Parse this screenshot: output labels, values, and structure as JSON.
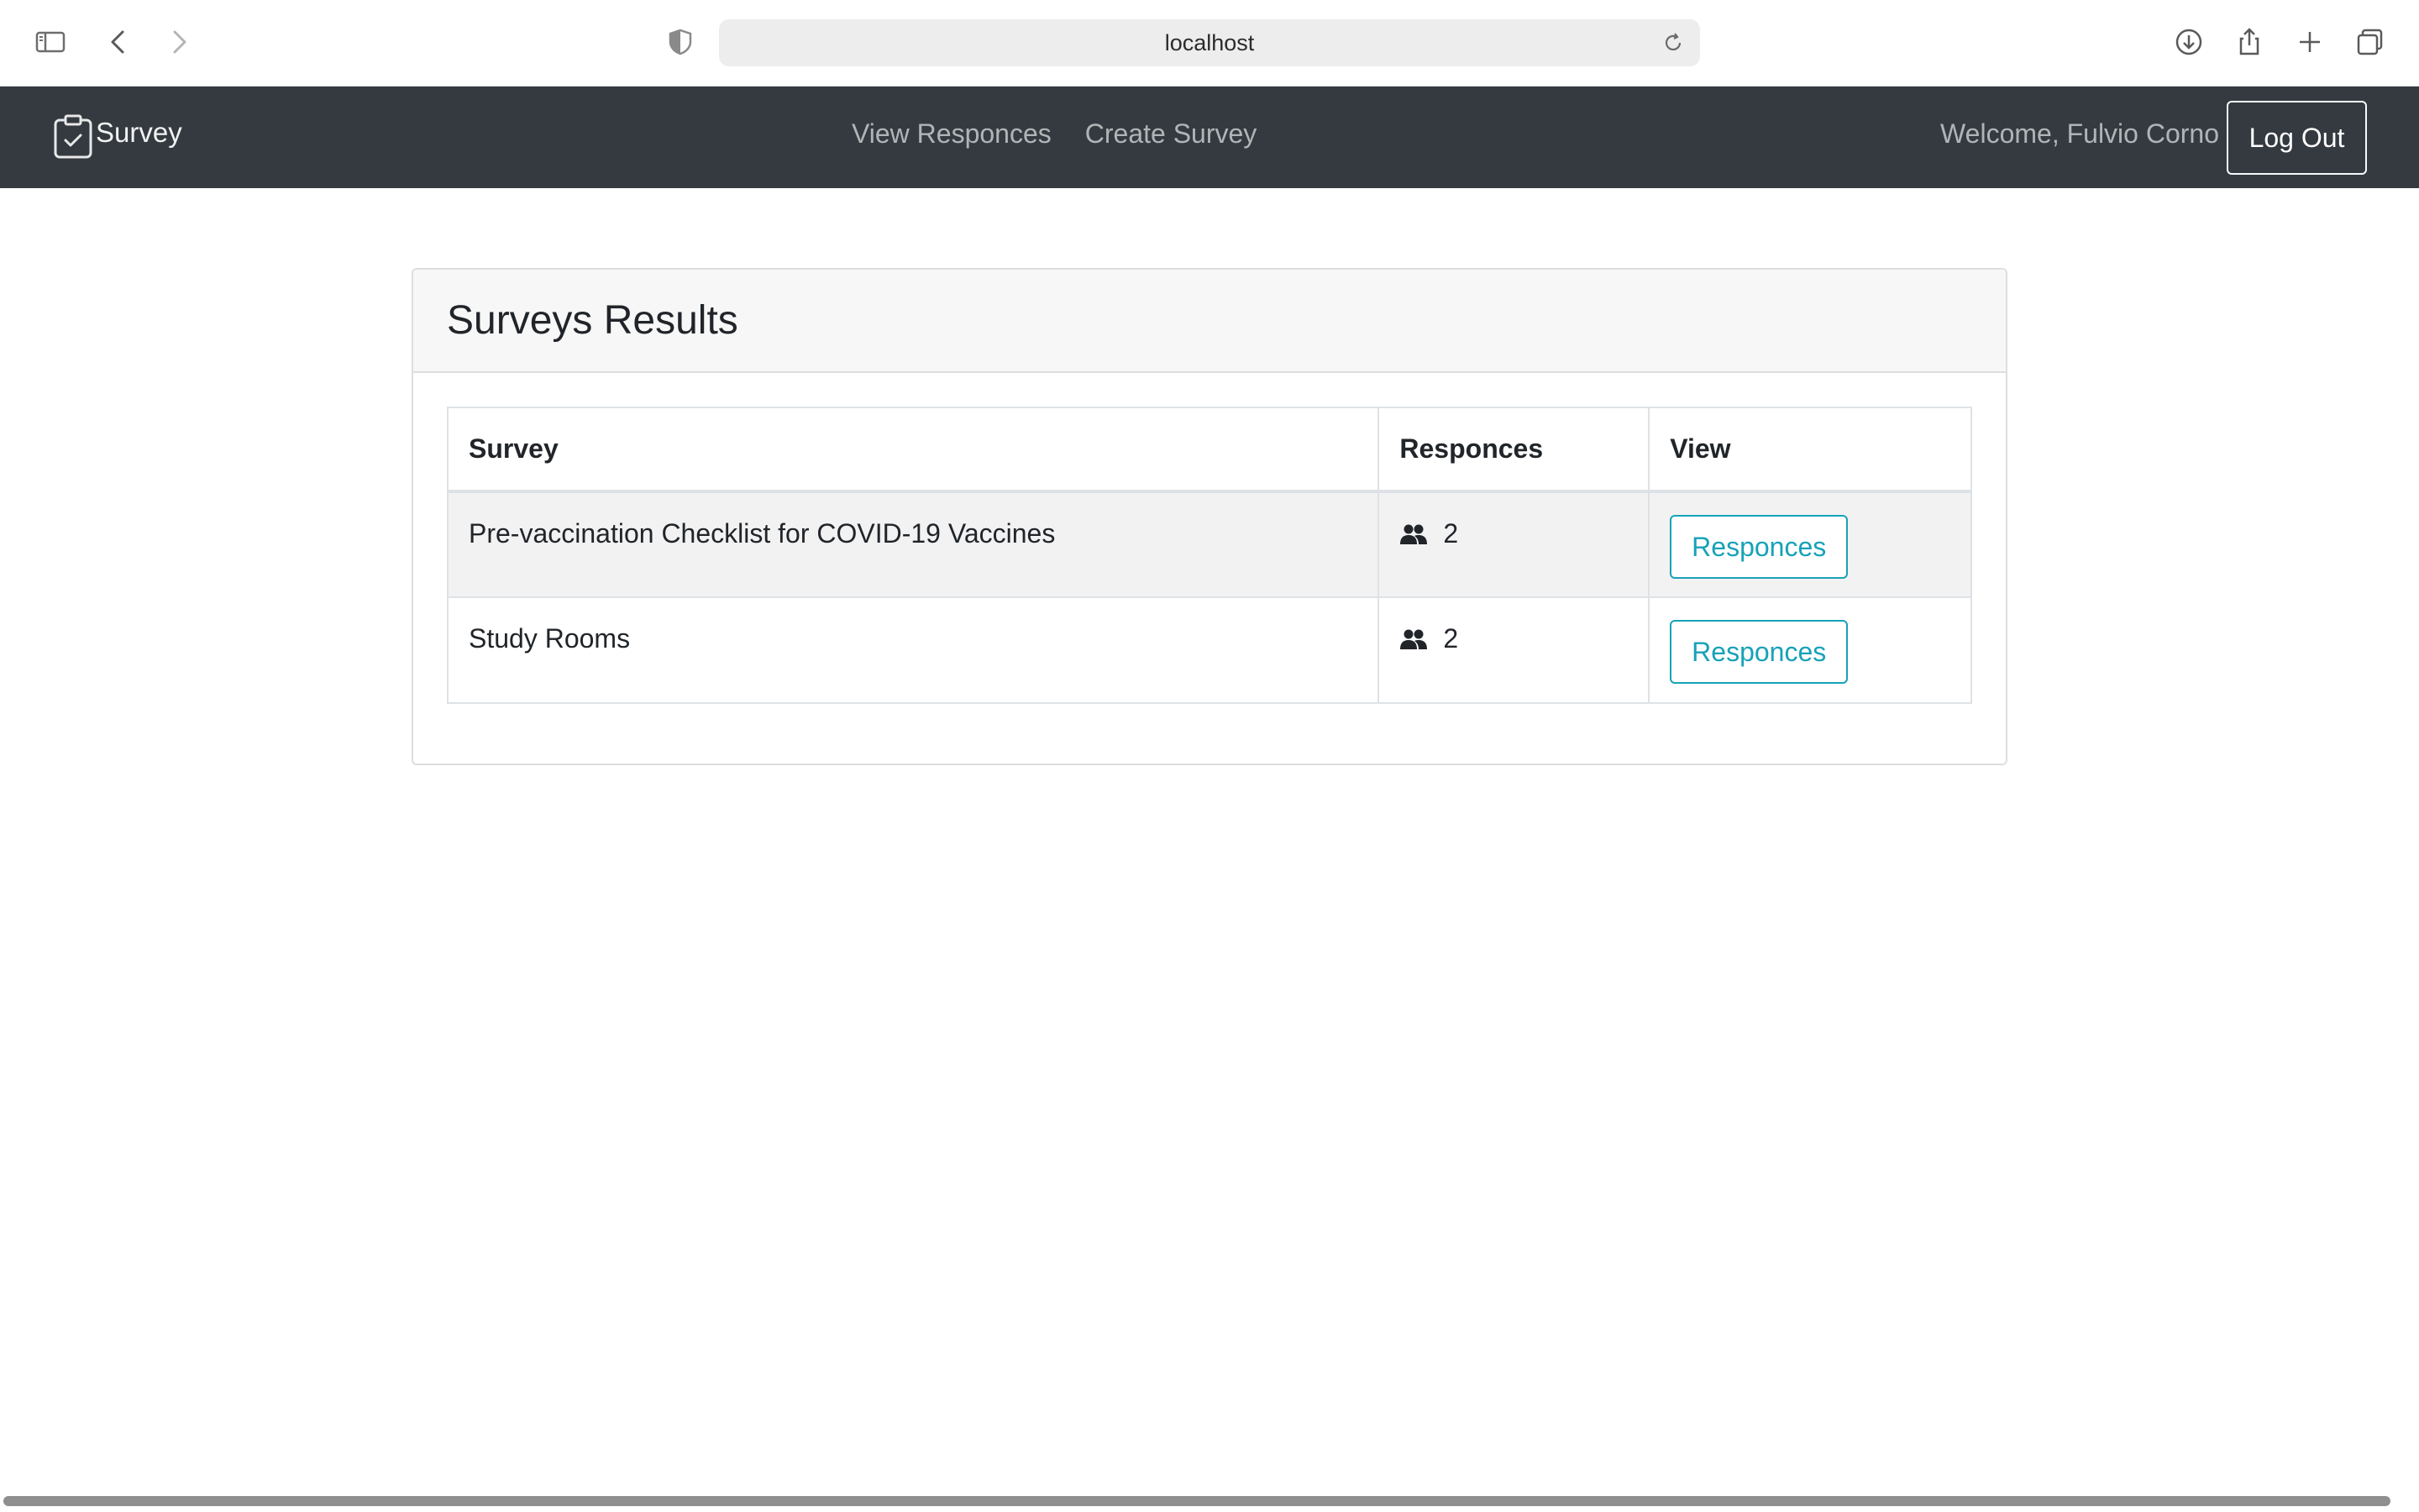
{
  "browser": {
    "url": "localhost",
    "icons": [
      "sidebar-icon",
      "back-icon",
      "forward-icon",
      "shield-icon",
      "reload-icon",
      "download-icon",
      "share-icon",
      "plus-icon",
      "tabs-icon"
    ]
  },
  "navbar": {
    "brand": "Survey",
    "brand_icon": "clipboard-check-icon",
    "links": [
      "View Responces",
      "Create Survey"
    ],
    "welcome": "Welcome, Fulvio Corno",
    "logout": "Log Out",
    "bg_color": "#343a40"
  },
  "card": {
    "title": "Surveys Results",
    "table": {
      "headers": [
        "Survey",
        "Responces",
        "View"
      ],
      "rows": [
        {
          "survey": "Pre-vaccination Checklist for COVID-19 Vaccines",
          "responses": "2",
          "button": "Responces"
        },
        {
          "survey": "Study Rooms",
          "responses": "2",
          "button": "Responces"
        }
      ]
    }
  },
  "colors": {
    "accent": "#17a2b8",
    "stripe": "#f2f2f2"
  }
}
